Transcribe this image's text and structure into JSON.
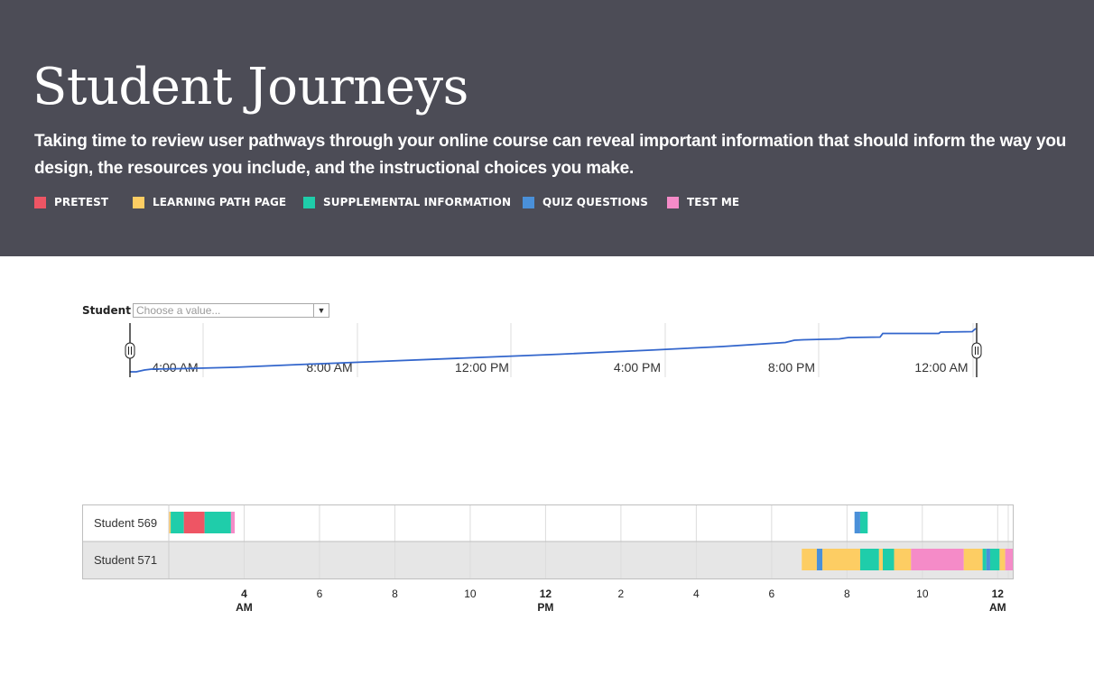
{
  "header": {
    "title": "Student Journeys",
    "subtitle": "Taking time to review user pathways through your online course can reveal important information that should inform the way you design, the resources you include, and the instructional choices you make."
  },
  "legend": [
    {
      "label": "PRETEST",
      "color": "#ee5564"
    },
    {
      "label": "LEARNING PATH PAGE",
      "color": "#fdcd63"
    },
    {
      "label": "SUPPLEMENTAL INFORMATION",
      "color": "#1fcdaa"
    },
    {
      "label": "QUIZ QUESTIONS",
      "color": "#4a90d9"
    },
    {
      "label": "TEST ME",
      "color": "#f58bc8"
    }
  ],
  "filter": {
    "label": "Student",
    "placeholder": "Choose a value..."
  },
  "range_control": {
    "ticks": [
      "4:00 AM",
      "8:00 AM",
      "12:00 PM",
      "4:00 PM",
      "8:00 PM",
      "12:00 AM"
    ],
    "line_color": "#3366cc"
  },
  "chart_data": {
    "type": "timeline",
    "x_unit": "hours since midnight",
    "x_range": [
      2.0,
      24.4
    ],
    "x_ticks": [
      {
        "value": 4,
        "label": "4",
        "sub": "AM"
      },
      {
        "value": 6,
        "label": "6",
        "sub": ""
      },
      {
        "value": 8,
        "label": "8",
        "sub": ""
      },
      {
        "value": 10,
        "label": "10",
        "sub": ""
      },
      {
        "value": 12,
        "label": "12",
        "sub": "PM"
      },
      {
        "value": 14,
        "label": "2",
        "sub": ""
      },
      {
        "value": 16,
        "label": "4",
        "sub": ""
      },
      {
        "value": 18,
        "label": "6",
        "sub": ""
      },
      {
        "value": 20,
        "label": "8",
        "sub": ""
      },
      {
        "value": 22,
        "label": "10",
        "sub": ""
      },
      {
        "value": 24,
        "label": "12",
        "sub": "AM"
      }
    ],
    "rows": [
      {
        "label": "Student 569",
        "segments": [
          {
            "start": 2.0,
            "end": 2.05,
            "category": "LEARNING PATH PAGE"
          },
          {
            "start": 2.05,
            "end": 2.4,
            "category": "SUPPLEMENTAL INFORMATION"
          },
          {
            "start": 2.4,
            "end": 2.95,
            "category": "PRETEST"
          },
          {
            "start": 2.95,
            "end": 3.65,
            "category": "SUPPLEMENTAL INFORMATION"
          },
          {
            "start": 3.65,
            "end": 3.75,
            "category": "TEST ME"
          },
          {
            "start": 20.2,
            "end": 20.35,
            "category": "QUIZ QUESTIONS"
          },
          {
            "start": 20.35,
            "end": 20.55,
            "category": "SUPPLEMENTAL INFORMATION"
          }
        ]
      },
      {
        "label": "Student 571",
        "segments": [
          {
            "start": 18.8,
            "end": 19.2,
            "category": "LEARNING PATH PAGE"
          },
          {
            "start": 19.2,
            "end": 19.35,
            "category": "QUIZ QUESTIONS"
          },
          {
            "start": 19.35,
            "end": 20.35,
            "category": "LEARNING PATH PAGE"
          },
          {
            "start": 20.35,
            "end": 20.85,
            "category": "SUPPLEMENTAL INFORMATION"
          },
          {
            "start": 20.85,
            "end": 20.95,
            "category": "LEARNING PATH PAGE"
          },
          {
            "start": 20.95,
            "end": 21.25,
            "category": "SUPPLEMENTAL INFORMATION"
          },
          {
            "start": 21.25,
            "end": 21.7,
            "category": "LEARNING PATH PAGE"
          },
          {
            "start": 21.7,
            "end": 23.1,
            "category": "TEST ME"
          },
          {
            "start": 23.1,
            "end": 23.6,
            "category": "LEARNING PATH PAGE"
          },
          {
            "start": 23.6,
            "end": 23.7,
            "category": "SUPPLEMENTAL INFORMATION"
          },
          {
            "start": 23.7,
            "end": 23.8,
            "category": "QUIZ QUESTIONS"
          },
          {
            "start": 23.8,
            "end": 24.05,
            "category": "SUPPLEMENTAL INFORMATION"
          },
          {
            "start": 24.05,
            "end": 24.2,
            "category": "LEARNING PATH PAGE"
          },
          {
            "start": 24.2,
            "end": 24.4,
            "category": "TEST ME"
          }
        ]
      }
    ]
  }
}
